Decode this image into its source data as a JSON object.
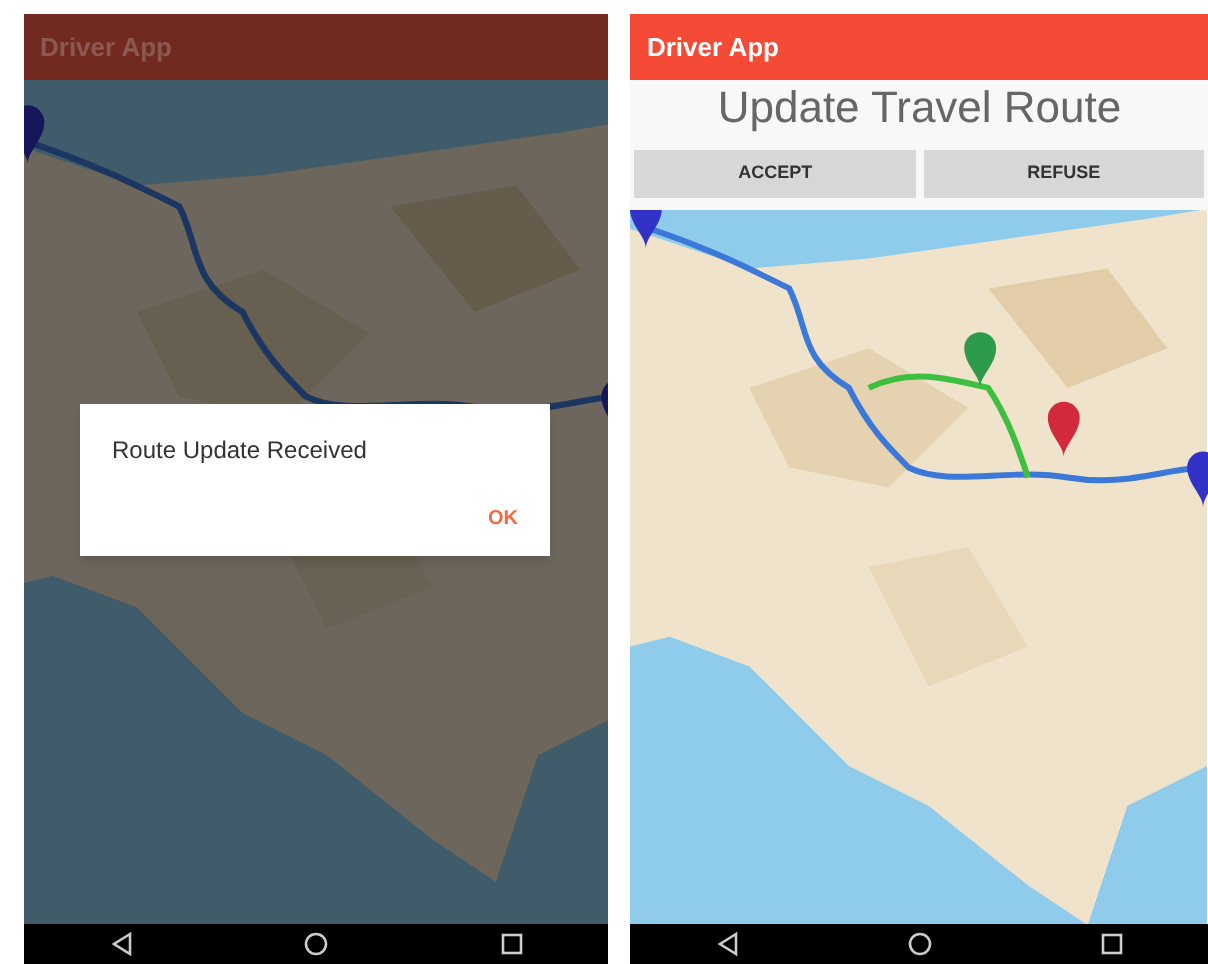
{
  "screens": [
    {
      "title": "Driver App",
      "dimmed": true,
      "dialog": {
        "message": "Route Update Received",
        "button": "OK"
      }
    },
    {
      "title": "Driver App",
      "dimmed": false,
      "heading": "Update Travel Route",
      "buttons": [
        "ACCEPT",
        "REFUSE"
      ]
    }
  ]
}
